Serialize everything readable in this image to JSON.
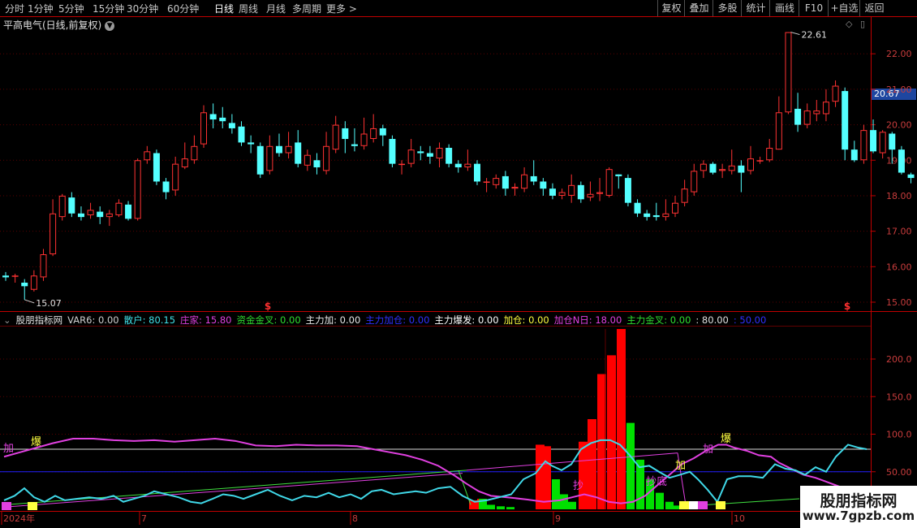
{
  "toolbar": {
    "periods": [
      "分时",
      "1分钟",
      "5分钟",
      "15分钟",
      "30分钟",
      "60分钟",
      "日线",
      "周线",
      "月线",
      "多周期",
      "更多 >"
    ],
    "active_period": "日线",
    "actions": [
      "复权",
      "叠加",
      "多股",
      "统计",
      "画线",
      "F10",
      "+自选",
      "返回"
    ]
  },
  "stock": {
    "title": "平高电气(日线,前复权)",
    "current_price_tag": "20.67",
    "high_label": "22.61",
    "low_label": "15.07",
    "signal_marks": [
      "$",
      "$"
    ]
  },
  "price_axis": {
    "ticks": [
      "22.00",
      "21.00",
      "20.00",
      "19.00",
      "18.00",
      "17.00",
      "16.00",
      "15.00"
    ]
  },
  "indicator": {
    "name": "股朋指标网",
    "items": [
      {
        "text": "VAR6: 0.00",
        "color": "#d0d0d0"
      },
      {
        "text": "散户: 80.15",
        "color": "#40e0e8"
      },
      {
        "text": "庄家: 15.80",
        "color": "#e040e0"
      },
      {
        "text": "资金金叉: 0.00",
        "color": "#30e030"
      },
      {
        "text": "主力加: 0.00",
        "color": "#e8e8e8"
      },
      {
        "text": "主力加仓: 0.00",
        "color": "#3030ff"
      },
      {
        "text": "主力爆发: 0.00",
        "color": "#ffffff"
      },
      {
        "text": "加仓: 0.00",
        "color": "#ffff40"
      },
      {
        "text": "加仓N日: 18.00",
        "color": "#e040e0"
      },
      {
        "text": "主力金叉: 0.00",
        "color": "#30e030"
      },
      {
        "text": ": 80.00",
        "color": "#e0e0e0"
      },
      {
        "text": ": 50.00",
        "color": "#3030ff"
      }
    ],
    "axis_ticks": [
      "200.0",
      "150.0",
      "100.0",
      "50.00"
    ],
    "annotations": [
      {
        "text": "加",
        "color": "#e040e0"
      },
      {
        "text": "爆",
        "color": "#ffff40"
      },
      {
        "text": "抄",
        "color": "#e040e0"
      },
      {
        "text": "抄底",
        "color": "#e040e0"
      },
      {
        "text": "加",
        "color": "#ffff40"
      },
      {
        "text": "加",
        "color": "#e040e0"
      },
      {
        "text": "爆",
        "color": "#ffff40"
      }
    ]
  },
  "date_axis": {
    "labels": [
      "2024年",
      "7",
      "8",
      "9",
      "10"
    ]
  },
  "watermark": {
    "name": "股朋指标网",
    "url": "www.7gpzb.com"
  },
  "chart_data": [
    {
      "type": "candlestick",
      "title": "平高电气(日线,前复权)",
      "ylim": [
        14.8,
        22.9
      ],
      "candles": [
        [
          15.75,
          15.7,
          15.85,
          15.6
        ],
        [
          15.72,
          15.75,
          15.8,
          15.55
        ],
        [
          15.55,
          15.45,
          15.65,
          15.07
        ],
        [
          15.35,
          15.75,
          15.9,
          15.3
        ],
        [
          15.7,
          16.35,
          16.5,
          15.6
        ],
        [
          16.35,
          17.5,
          17.9,
          16.3
        ],
        [
          17.4,
          18.0,
          18.05,
          17.3
        ],
        [
          17.95,
          17.5,
          18.1,
          17.4
        ],
        [
          17.5,
          17.4,
          17.7,
          17.3
        ],
        [
          17.45,
          17.6,
          17.8,
          17.35
        ],
        [
          17.55,
          17.4,
          17.7,
          17.2
        ],
        [
          17.4,
          17.5,
          17.6,
          17.15
        ],
        [
          17.45,
          17.8,
          17.9,
          17.4
        ],
        [
          17.75,
          17.35,
          17.85,
          17.3
        ],
        [
          17.35,
          19.0,
          19.05,
          17.3
        ],
        [
          19.0,
          19.25,
          19.4,
          18.9
        ],
        [
          19.2,
          18.4,
          19.3,
          18.3
        ],
        [
          18.4,
          18.1,
          18.5,
          17.9
        ],
        [
          18.15,
          18.9,
          19.1,
          18.0
        ],
        [
          18.8,
          19.05,
          19.5,
          18.75
        ],
        [
          19.0,
          19.4,
          19.7,
          18.9
        ],
        [
          19.45,
          20.35,
          20.55,
          19.35
        ],
        [
          20.3,
          20.15,
          20.6,
          19.9
        ],
        [
          20.2,
          20.1,
          20.5,
          19.9
        ],
        [
          20.05,
          19.9,
          20.3,
          19.75
        ],
        [
          19.95,
          19.5,
          20.1,
          19.4
        ],
        [
          19.5,
          19.45,
          19.7,
          19.2
        ],
        [
          19.4,
          18.6,
          19.5,
          18.5
        ],
        [
          18.7,
          19.4,
          19.7,
          18.6
        ],
        [
          19.4,
          19.2,
          19.75,
          19.1
        ],
        [
          19.2,
          19.4,
          19.8,
          19.05
        ],
        [
          19.5,
          18.9,
          19.85,
          18.8
        ],
        [
          18.85,
          19.15,
          19.3,
          18.7
        ],
        [
          19.0,
          18.8,
          19.2,
          18.6
        ],
        [
          18.7,
          19.4,
          19.8,
          18.6
        ],
        [
          19.3,
          20.0,
          20.25,
          19.2
        ],
        [
          19.9,
          19.6,
          20.1,
          19.2
        ],
        [
          19.45,
          19.4,
          19.9,
          19.25
        ],
        [
          19.4,
          19.75,
          20.2,
          19.3
        ],
        [
          19.6,
          19.9,
          20.3,
          19.5
        ],
        [
          19.9,
          19.7,
          20.0,
          19.4
        ],
        [
          19.6,
          18.9,
          19.7,
          18.8
        ],
        [
          18.9,
          18.9,
          19.0,
          18.6
        ],
        [
          18.9,
          19.3,
          19.6,
          18.8
        ],
        [
          19.25,
          19.2,
          19.4,
          19.0
        ],
        [
          19.2,
          19.1,
          19.4,
          18.9
        ],
        [
          19.05,
          19.35,
          19.5,
          18.8
        ],
        [
          19.35,
          18.9,
          19.45,
          18.8
        ],
        [
          18.9,
          18.8,
          19.0,
          18.65
        ],
        [
          18.8,
          18.9,
          19.3,
          18.7
        ],
        [
          18.9,
          18.4,
          19.0,
          18.3
        ],
        [
          18.4,
          18.4,
          18.5,
          18.1
        ],
        [
          18.3,
          18.5,
          18.6,
          18.2
        ],
        [
          18.55,
          18.2,
          18.7,
          18.0
        ],
        [
          18.2,
          18.25,
          18.35,
          18.0
        ],
        [
          18.2,
          18.6,
          18.8,
          18.1
        ],
        [
          18.55,
          18.4,
          19.0,
          18.3
        ],
        [
          18.4,
          18.2,
          18.5,
          18.0
        ],
        [
          18.2,
          18.0,
          18.35,
          17.9
        ],
        [
          18.0,
          18.1,
          18.2,
          17.9
        ],
        [
          18.0,
          18.3,
          18.6,
          17.8
        ],
        [
          18.3,
          17.9,
          18.4,
          17.8
        ],
        [
          17.95,
          18.05,
          18.4,
          17.85
        ],
        [
          18.05,
          18.1,
          18.5,
          17.85
        ],
        [
          18.0,
          18.75,
          18.8,
          17.95
        ],
        [
          18.6,
          18.55,
          18.6,
          18.2
        ],
        [
          18.5,
          17.8,
          18.6,
          17.7
        ],
        [
          17.8,
          17.5,
          17.9,
          17.4
        ],
        [
          17.5,
          17.4,
          17.6,
          17.3
        ],
        [
          17.45,
          17.4,
          17.8,
          17.3
        ],
        [
          17.4,
          17.5,
          17.9,
          17.3
        ],
        [
          17.5,
          17.8,
          18.0,
          17.4
        ],
        [
          17.8,
          18.2,
          18.45,
          17.7
        ],
        [
          18.1,
          18.7,
          18.9,
          18.0
        ],
        [
          18.7,
          18.9,
          19.0,
          18.5
        ],
        [
          18.9,
          18.65,
          18.95,
          18.6
        ],
        [
          18.7,
          18.75,
          18.9,
          18.5
        ],
        [
          18.7,
          18.85,
          19.3,
          18.6
        ],
        [
          18.85,
          18.65,
          19.0,
          18.1
        ],
        [
          18.7,
          19.05,
          19.4,
          18.6
        ],
        [
          19.0,
          19.0,
          19.1,
          18.9
        ],
        [
          19.0,
          19.35,
          19.6,
          18.95
        ],
        [
          19.3,
          20.35,
          20.8,
          19.3
        ],
        [
          20.35,
          22.61,
          22.61,
          20.3
        ],
        [
          20.45,
          20.0,
          20.9,
          19.8
        ],
        [
          20.0,
          20.4,
          20.6,
          19.9
        ],
        [
          20.3,
          20.4,
          20.7,
          20.1
        ],
        [
          20.3,
          20.65,
          21.0,
          20.1
        ],
        [
          20.65,
          21.1,
          21.25,
          20.5
        ],
        [
          20.95,
          19.3,
          21.05,
          19.0
        ],
        [
          19.3,
          19.0,
          19.55,
          18.95
        ],
        [
          19.0,
          19.85,
          20.0,
          18.9
        ],
        [
          19.85,
          19.25,
          20.15,
          19.2
        ],
        [
          19.2,
          19.8,
          19.85,
          19.05
        ],
        [
          19.75,
          19.3,
          19.8,
          18.9
        ],
        [
          19.3,
          18.65,
          19.4,
          18.6
        ],
        [
          18.6,
          18.5,
          18.65,
          18.35
        ],
        [
          18.5,
          18.0,
          18.6,
          17.9
        ],
        [
          18.0,
          18.1,
          18.3,
          17.85
        ],
        [
          18.1,
          18.3,
          18.6,
          18.0
        ]
      ]
    },
    {
      "type": "bar",
      "title": "股朋指标网",
      "ylim": [
        0,
        240
      ],
      "series": [
        {
          "name": "主力加仓",
          "values": [
            0,
            0,
            0,
            0,
            0,
            0,
            0,
            0,
            0,
            0,
            0,
            0,
            0,
            0,
            0,
            0,
            0,
            0,
            0,
            0,
            0,
            0,
            0,
            0,
            0,
            0,
            0,
            0,
            0,
            0,
            0,
            0,
            0,
            0,
            0,
            0,
            0,
            0,
            0,
            0,
            0,
            0,
            0,
            0,
            0,
            0,
            0,
            0,
            0,
            0,
            0,
            0,
            0,
            0,
            0,
            0,
            0,
            0,
            0,
            0,
            0,
            0,
            0,
            0,
            0,
            0,
            0,
            0,
            0,
            0,
            0,
            0,
            0,
            0,
            0,
            0,
            0,
            0,
            0,
            0,
            0,
            0,
            0,
            0,
            0,
            0,
            0,
            0,
            0,
            0,
            0,
            0,
            0,
            0,
            0,
            0,
            0,
            0,
            0,
            0
          ]
        }
      ]
    }
  ]
}
